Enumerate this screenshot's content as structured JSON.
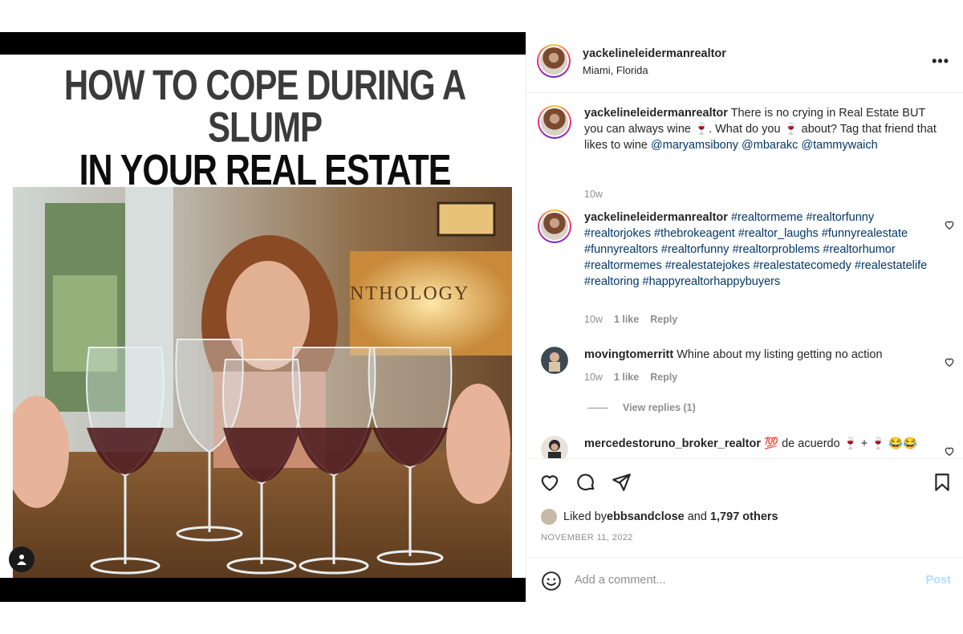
{
  "post": {
    "headline_line1": "HOW TO COPE DURING A SLUMP",
    "headline_line2": "IN YOUR REAL ESTATE CAREER",
    "photo_sign_text": "NTHOLOGY"
  },
  "header": {
    "username": "yackelineleidermanrealtor",
    "location": "Miami, Florida",
    "more_label": "•••"
  },
  "comments": [
    {
      "username": "yackelineleidermanrealtor",
      "text_before": " There is no crying in Real Estate BUT you can always wine 🍷. What do you 🍷 about? Tag that friend that likes to wine ",
      "mentions": [
        "@maryamsibony",
        "@mbarakc",
        "@tammywaich"
      ],
      "time": "10w"
    },
    {
      "username": "yackelineleidermanrealtor",
      "hashtags": "#realtormeme #realtorfunny #realtorjokes #thebrokeagent #realtor_laughs #funnyrealestate #funnyrealtors #realtorfunny #realtorproblems #realtorhumor #realtormemes #realestatejokes #realestatecomedy #realestatelife #realtoring #happyrealtorhappybuyers",
      "time": "10w",
      "likes": "1 like",
      "reply": "Reply"
    },
    {
      "username": "movingtomerritt",
      "text": " Whine about my listing getting no action",
      "time": "10w",
      "likes": "1 like",
      "reply": "Reply",
      "view_replies": "View replies (1)"
    },
    {
      "username": "mercedestoruno_broker_realtor",
      "text": " 💯 de acuerdo 🍷 + 🍷 😂😂"
    }
  ],
  "actions": {
    "liked_by_prefix": "Liked by ",
    "liked_by_user": "ebbsandclose",
    "liked_by_and": " and ",
    "liked_by_others": "1,797 others",
    "date": "NOVEMBER 11, 2022"
  },
  "add_comment": {
    "placeholder": "Add a comment...",
    "post_label": "Post"
  },
  "colors": {
    "link": "#00376b",
    "muted": "#8e8e8e",
    "post_disabled": "#b3dbff"
  }
}
